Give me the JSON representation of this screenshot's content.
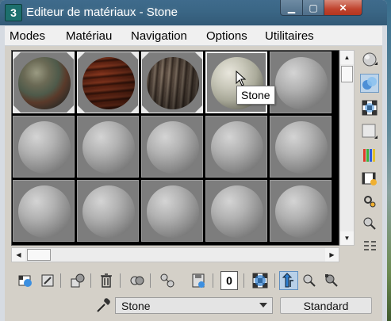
{
  "window": {
    "title": "Editeur de matériaux - Stone",
    "app_icon_label": "3"
  },
  "caption_buttons": {
    "minimize": "▁",
    "maximize": "▢",
    "close": "✕"
  },
  "menu": {
    "items": [
      "Modes",
      "Matériau",
      "Navigation",
      "Options",
      "Utilitaires"
    ]
  },
  "slots": {
    "materials": [
      {
        "kind": "stone-map"
      },
      {
        "kind": "wood-red"
      },
      {
        "kind": "wood-dark"
      },
      {
        "kind": "stone-light"
      },
      {
        "kind": "default"
      },
      {
        "kind": "default"
      },
      {
        "kind": "default"
      },
      {
        "kind": "default"
      },
      {
        "kind": "default"
      },
      {
        "kind": "default"
      },
      {
        "kind": "default"
      },
      {
        "kind": "default"
      },
      {
        "kind": "default"
      },
      {
        "kind": "default"
      },
      {
        "kind": "default"
      }
    ],
    "tooltip": "Stone"
  },
  "side_tools": [
    "sample-type-icon",
    "backlight-icon",
    "background-checker-icon",
    "sample-uv-tiling-icon",
    "video-color-check-icon",
    "make-preview-icon",
    "options-icon",
    "select-by-material-icon",
    "material-map-navigator-icon"
  ],
  "bottom_tools": [
    "get-material-icon",
    "put-to-scene-icon",
    "assign-to-selection-icon",
    "reset-map-icon",
    "copy-material-icon",
    "make-unique-icon",
    "put-to-library-icon",
    "material-id-channel-icon",
    "show-shaded-icon",
    "show-end-result-icon",
    "go-to-parent-icon",
    "go-forward-sibling-icon"
  ],
  "material_id_channel": "0",
  "name_field": {
    "value": "Stone"
  },
  "type_button": {
    "label": "Standard"
  },
  "colors": {
    "title_bar": "#3a6685",
    "client_bg": "#d4d0c8",
    "close_button": "#c0432d",
    "accent_blue": "#2f7fd0"
  }
}
